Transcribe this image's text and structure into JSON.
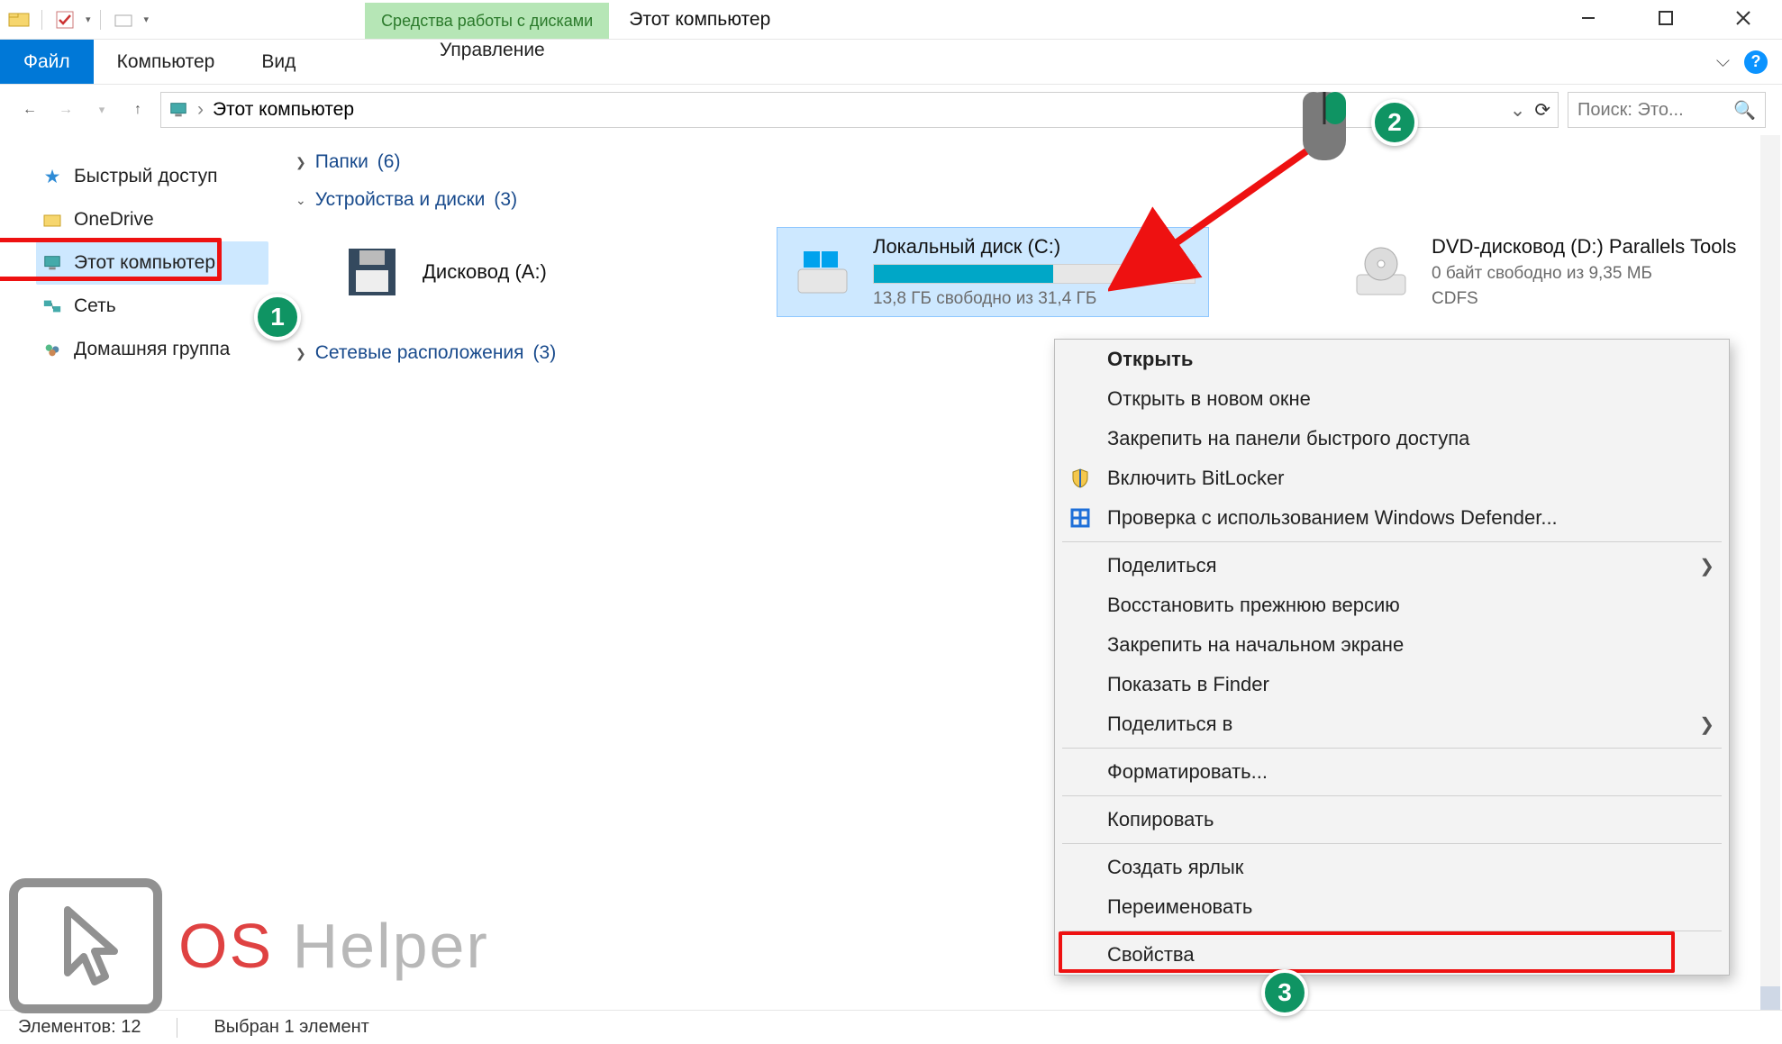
{
  "titlebar": {
    "context_tab_label": "Средства работы с дисками",
    "window_title": "Этот компьютер"
  },
  "ribbon": {
    "tabs": {
      "file": "Файл",
      "computer": "Компьютер",
      "view": "Вид",
      "manage": "Управление"
    }
  },
  "nav": {
    "address_text": "Этот компьютер",
    "search_placeholder": "Поиск: Это..."
  },
  "sidebar": {
    "items": [
      {
        "label": "Быстрый доступ"
      },
      {
        "label": "OneDrive"
      },
      {
        "label": "Этот компьютер"
      },
      {
        "label": "Сеть"
      },
      {
        "label": "Домашняя группа"
      }
    ]
  },
  "groups": {
    "folders": {
      "label": "Папки",
      "count": "(6)"
    },
    "devices": {
      "label": "Устройства и диски",
      "count": "(3)"
    },
    "network": {
      "label": "Сетевые расположения",
      "count": "(3)"
    }
  },
  "drives": {
    "floppy": {
      "title": "Дисковод (A:)"
    },
    "c": {
      "title": "Локальный диск (C:)",
      "sub": "13,8 ГБ свободно из 31,4 ГБ",
      "usage_pct": 56
    },
    "dvd": {
      "title": "DVD-дисковод (D:) Parallels Tools",
      "sub": "0 байт свободно из 9,35 МБ",
      "fs": "CDFS"
    }
  },
  "context_menu": {
    "open": "Открыть",
    "open_new_window": "Открыть в новом окне",
    "pin_quick": "Закрепить на панели быстрого доступа",
    "bitlocker": "Включить BitLocker",
    "defender": "Проверка с использованием Windows Defender...",
    "share": "Поделиться",
    "restore_prev": "Восстановить прежнюю версию",
    "pin_start": "Закрепить на начальном экране",
    "show_in_finder": "Показать в Finder",
    "share_in": "Поделиться в",
    "format": "Форматировать...",
    "copy": "Копировать",
    "create_shortcut": "Создать ярлык",
    "rename": "Переименовать",
    "properties": "Свойства"
  },
  "status": {
    "items_count": "Элементов: 12",
    "selected": "Выбран 1 элемент"
  },
  "callouts": {
    "one": "1",
    "two": "2",
    "three": "3"
  },
  "watermark": {
    "os": "OS",
    "rest": " Helper"
  }
}
